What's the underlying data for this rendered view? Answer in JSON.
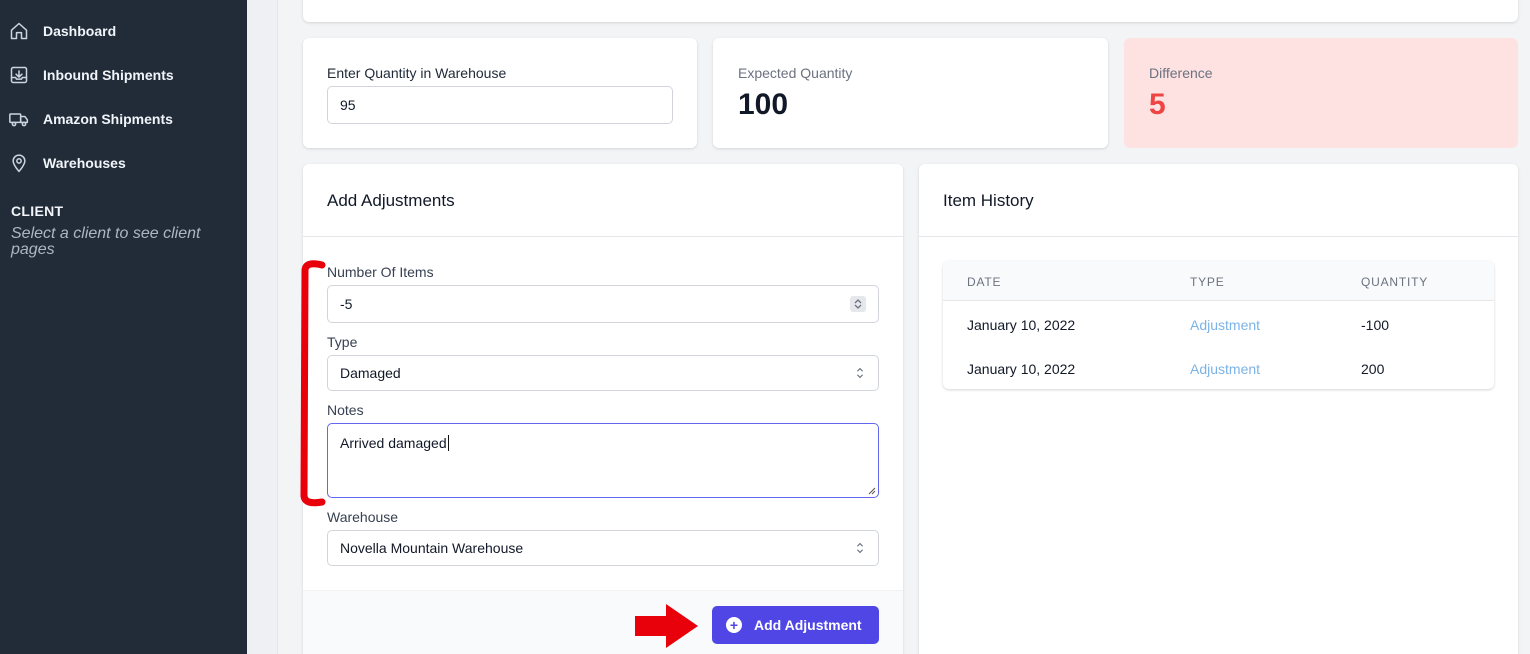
{
  "sidebar": {
    "items": [
      {
        "label": "Dashboard",
        "icon": "home-icon"
      },
      {
        "label": "Inbound Shipments",
        "icon": "inbox-download-icon"
      },
      {
        "label": "Amazon Shipments",
        "icon": "truck-icon"
      },
      {
        "label": "Warehouses",
        "icon": "map-pin-icon"
      }
    ],
    "client_title": "CLIENT",
    "client_hint": "Select a client to see client pages"
  },
  "stats": {
    "quantity_label": "Enter Quantity in Warehouse",
    "quantity_value": "95",
    "expected_label": "Expected Quantity",
    "expected_value": "100",
    "difference_label": "Difference",
    "difference_value": "5"
  },
  "adjustments": {
    "title": "Add Adjustments",
    "number_label": "Number Of Items",
    "number_value": "-5",
    "type_label": "Type",
    "type_value": "Damaged",
    "notes_label": "Notes",
    "notes_value": "Arrived damaged",
    "warehouse_label": "Warehouse",
    "warehouse_value": "Novella Mountain Warehouse",
    "add_button": "Add Adjustment"
  },
  "history": {
    "title": "Item History",
    "columns": [
      "DATE",
      "TYPE",
      "QUANTITY"
    ],
    "rows": [
      {
        "date": "January 10, 2022",
        "type": "Adjustment",
        "quantity": "-100"
      },
      {
        "date": "January 10, 2022",
        "type": "Adjustment",
        "quantity": "200"
      }
    ]
  },
  "colors": {
    "sidebar_bg": "#222b38",
    "accent": "#4f46e5",
    "difference_bg": "#fee2e2",
    "difference_text": "#ef4444",
    "annotation_red": "#e8000b"
  }
}
